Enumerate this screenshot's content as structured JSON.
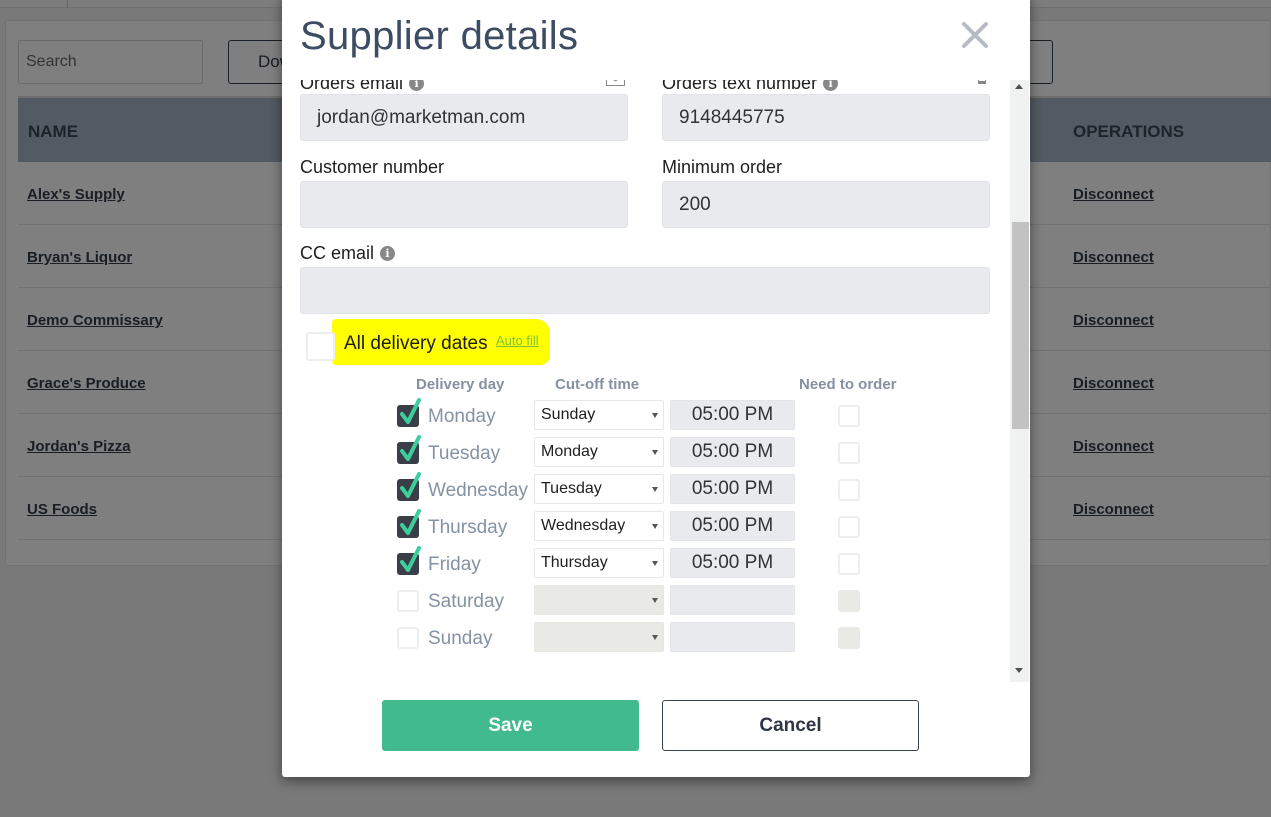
{
  "page": {
    "search_placeholder": "Search",
    "download_label": "Download",
    "table": {
      "headers": {
        "name": "NAME",
        "operations": "OPERATIONS"
      },
      "rows": [
        {
          "name": "Alex's Supply",
          "operation": "Disconnect"
        },
        {
          "name": "Bryan's Liquor",
          "operation": "Disconnect"
        },
        {
          "name": "Demo Commissary",
          "operation": "Disconnect"
        },
        {
          "name": "Grace's Produce",
          "operation": "Disconnect"
        },
        {
          "name": "Jordan's Pizza",
          "operation": "Disconnect"
        },
        {
          "name": "US Foods",
          "operation": "Disconnect"
        }
      ]
    }
  },
  "modal": {
    "title": "Supplier details",
    "close_icon": "close-icon",
    "fields": {
      "orders_email": {
        "label": "Orders email",
        "value": "jordan@marketman.com",
        "icon": "envelope-icon"
      },
      "orders_text_number": {
        "label": "Orders text number",
        "value": "9148445775",
        "icon": "phone-icon"
      },
      "customer_number": {
        "label": "Customer number",
        "value": ""
      },
      "minimum_order": {
        "label": "Minimum order",
        "value": "200"
      },
      "cc_email": {
        "label": "CC email",
        "value": ""
      }
    },
    "all_delivery_dates": {
      "label": "All delivery dates",
      "checked": false,
      "autofill_label": "Auto fill",
      "highlight_color": "#ffff00"
    },
    "schedule": {
      "headers": {
        "day": "Delivery day",
        "cutoff": "Cut-off time",
        "need": "Need to order"
      },
      "rows": [
        {
          "day": "Monday",
          "checked": true,
          "cutoff_day": "Sunday",
          "cutoff_time": "05:00 PM",
          "need_to_order": false
        },
        {
          "day": "Tuesday",
          "checked": true,
          "cutoff_day": "Monday",
          "cutoff_time": "05:00 PM",
          "need_to_order": false
        },
        {
          "day": "Wednesday",
          "checked": true,
          "cutoff_day": "Tuesday",
          "cutoff_time": "05:00 PM",
          "need_to_order": false
        },
        {
          "day": "Thursday",
          "checked": true,
          "cutoff_day": "Wednesday",
          "cutoff_time": "05:00 PM",
          "need_to_order": false
        },
        {
          "day": "Friday",
          "checked": true,
          "cutoff_day": "Thursday",
          "cutoff_time": "05:00 PM",
          "need_to_order": false
        },
        {
          "day": "Saturday",
          "checked": false,
          "cutoff_day": "",
          "cutoff_time": "",
          "need_to_order": false
        },
        {
          "day": "Sunday",
          "checked": false,
          "cutoff_day": "",
          "cutoff_time": "",
          "need_to_order": false
        }
      ]
    },
    "buttons": {
      "save": "Save",
      "cancel": "Cancel"
    },
    "colors": {
      "save": "#41bb8d",
      "check": "#3ccf9c",
      "title": "#3c4c63"
    }
  }
}
